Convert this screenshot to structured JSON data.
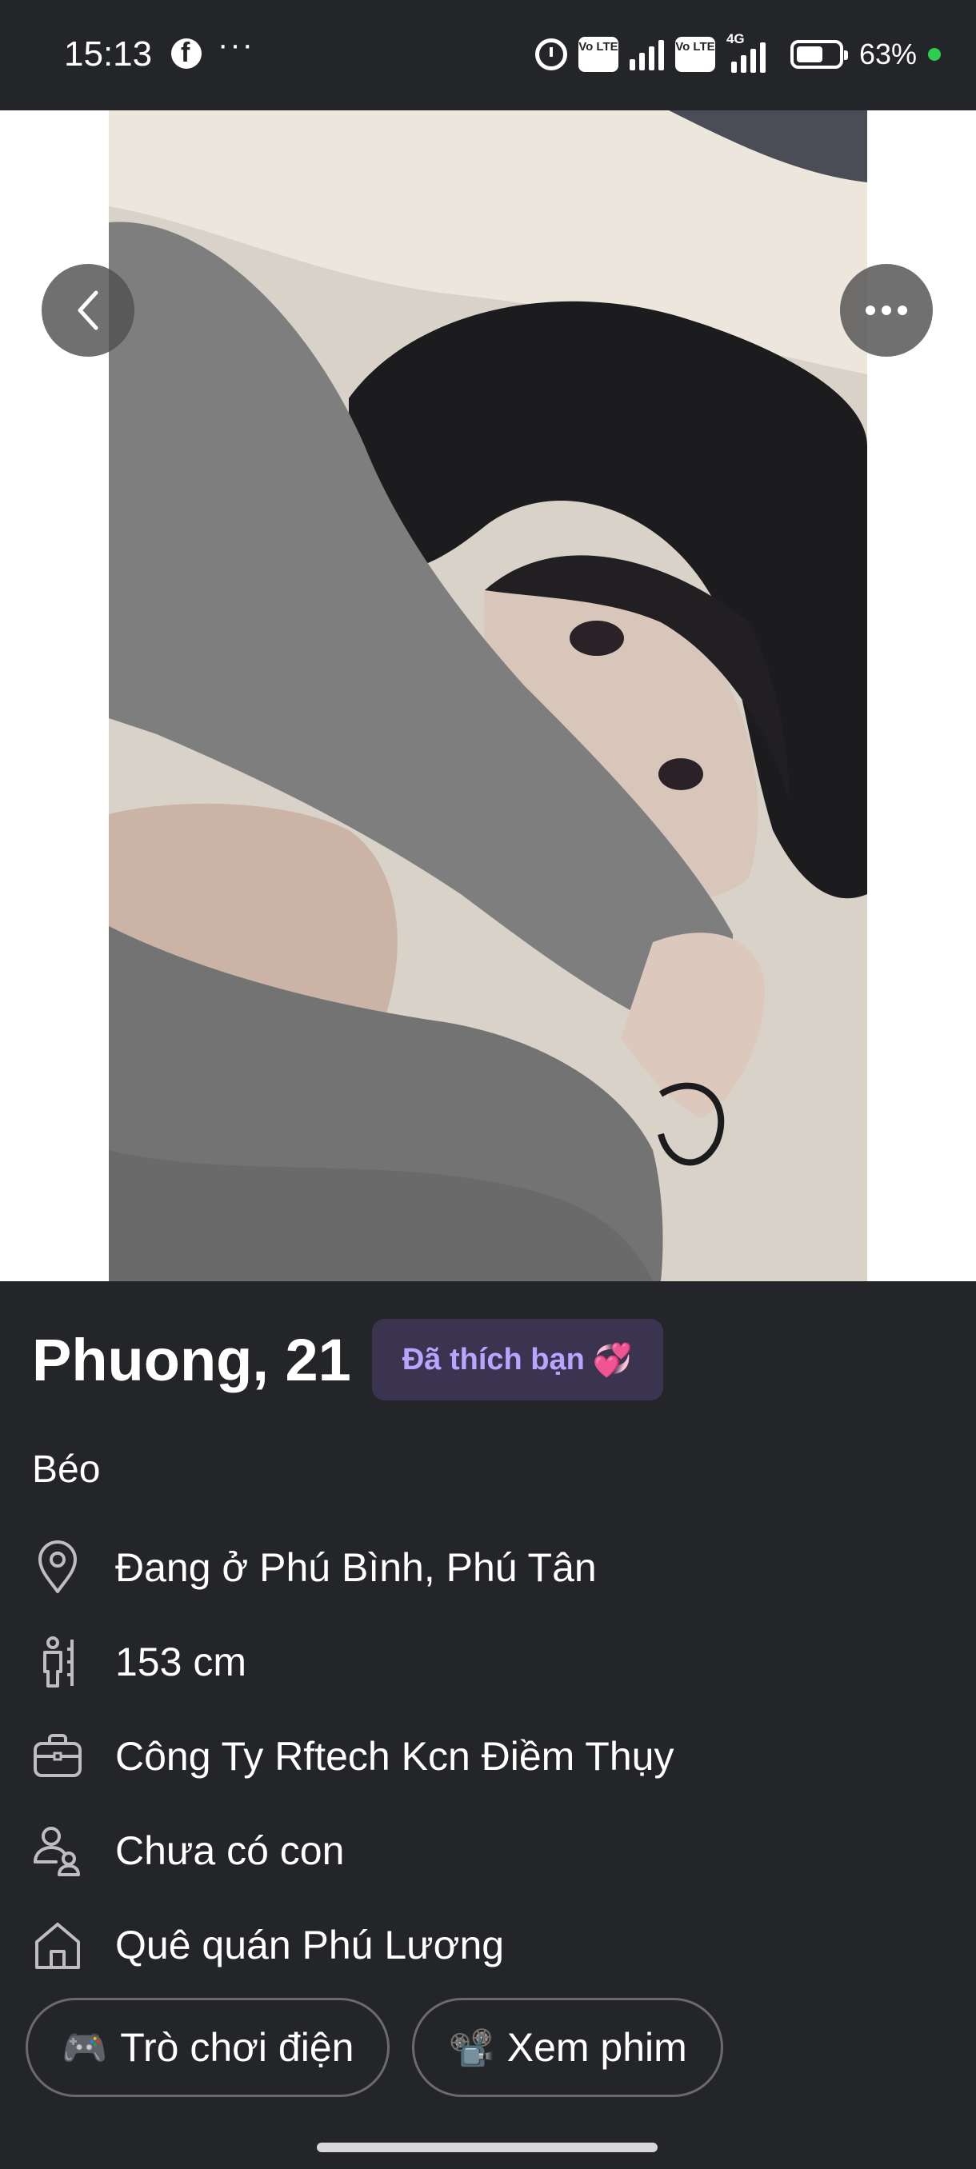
{
  "status_bar": {
    "time": "15:13",
    "more": "···",
    "volte_1": "Vo LTE",
    "volte_2": "Vo LTE",
    "network": "4G",
    "battery_percent": "63%",
    "battery_level": 0.63
  },
  "photo": {
    "description_icon": "profile-photo"
  },
  "profile": {
    "name_age": "Phuong, 21",
    "liked_badge": "Đã thích bạn",
    "liked_badge_emoji": "💞",
    "bio": "Béo",
    "details": [
      {
        "icon": "location-pin-icon",
        "text": "Đang ở Phú Bình, Phú Tân"
      },
      {
        "icon": "height-icon",
        "text": "153 cm"
      },
      {
        "icon": "briefcase-icon",
        "text": "Công Ty Rftech Kcn Điềm Thụy"
      },
      {
        "icon": "children-icon",
        "text": "Chưa có con"
      },
      {
        "icon": "home-icon",
        "text": "Quê quán Phú Lương"
      }
    ],
    "interests": [
      {
        "emoji": "🎮",
        "label": "Trò chơi điện"
      },
      {
        "emoji": "📽️",
        "label": "Xem phim"
      }
    ]
  },
  "colors": {
    "background": "#242528",
    "badge_bg": "#3b3450",
    "badge_text": "#b7a6ff",
    "chip_border": "#6a6a70"
  }
}
